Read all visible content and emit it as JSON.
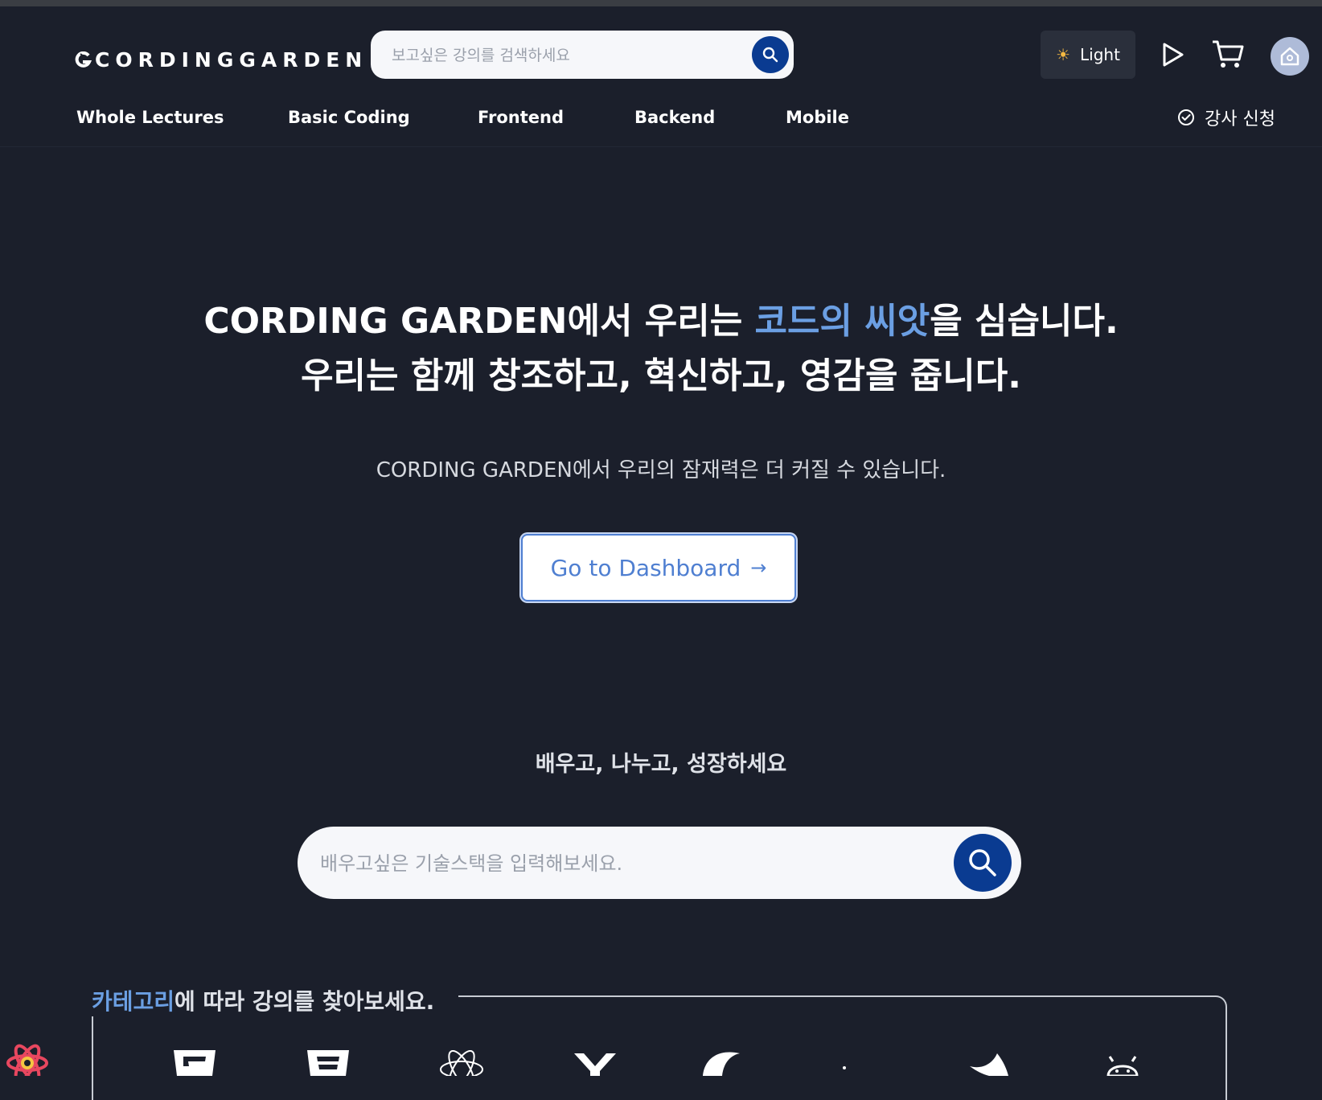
{
  "brand": {
    "logo_text": "CORDINGGARDEN"
  },
  "header": {
    "search": {
      "placeholder": "보고싶은 강의를 검색하세요",
      "value": ""
    },
    "theme_label": "Light",
    "nav": [
      {
        "label": "Whole Lectures"
      },
      {
        "label": "Basic Coding"
      },
      {
        "label": "Frontend"
      },
      {
        "label": "Backend"
      },
      {
        "label": "Mobile"
      }
    ],
    "instructor_label": "강사 신청"
  },
  "hero": {
    "line1_part1": "CORDING GARDEN에서 우리는 ",
    "line1_accent": "코드의 씨앗",
    "line1_part2": "을 심습니다.",
    "line2": "우리는 함께 창조하고, 혁신하고, 영감을 줍니다.",
    "subtitle": "CORDING GARDEN에서 우리의 잠재력은 더 커질 수 있습니다.",
    "cta_label": "Go to Dashboard",
    "cta_arrow": "→"
  },
  "learn": {
    "title": "배우고, 나누고, 성장하세요",
    "search": {
      "placeholder": "배우고싶은 기술스택을 입력해보세요.",
      "value": ""
    }
  },
  "categories": {
    "heading_accent": "카테고리",
    "heading_rest": "에 따라 강의를 찾아보세요.",
    "icons": [
      "html5-icon",
      "css3-icon",
      "react-icon",
      "nextjs-icon",
      "nodejs-icon",
      "express-icon",
      "swift-icon",
      "android-icon"
    ]
  },
  "colors": {
    "background": "#1b1f2b",
    "accent": "#6b9fe3",
    "brand_button": "#0a3b91",
    "theme_button": "#2a2f3b"
  }
}
